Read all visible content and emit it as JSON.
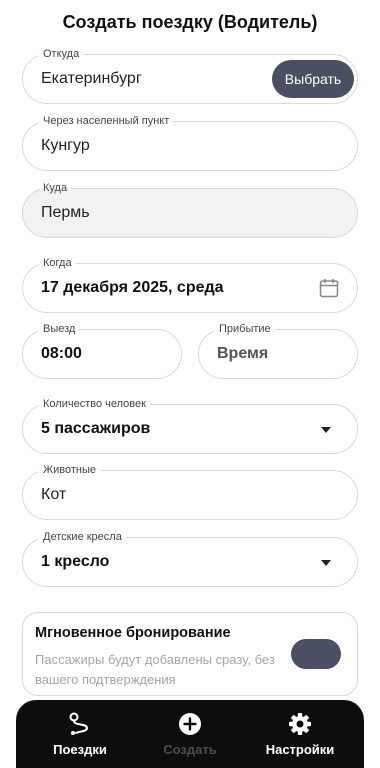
{
  "header": {
    "title": "Создать поездку (Водитель)"
  },
  "form": {
    "from": {
      "label": "Откуда",
      "value": "Екатеринбург",
      "button": "Выбрать"
    },
    "via": {
      "label": "Через населенный пункт",
      "value": "Кунгур"
    },
    "to": {
      "label": "Куда",
      "value": "Пермь"
    },
    "when": {
      "label": "Когда",
      "value": "17 декабря 2025, среда"
    },
    "departure": {
      "label": "Выезд",
      "value": "08:00"
    },
    "arrival": {
      "label": "Прибытие",
      "value": "Время"
    },
    "people": {
      "label": "Количество человек",
      "value": "5 пассажиров"
    },
    "animals": {
      "label": "Животные",
      "value": "Кот"
    },
    "child_seats": {
      "label": "Детские кресла",
      "value": "1 кресло"
    }
  },
  "instant_booking": {
    "title": "Мгновенное бронирование",
    "description": "Пассажиры будут добавлены сразу, без вашего подтверждения",
    "enabled": true
  },
  "nav": {
    "items": [
      {
        "label": "Поездки",
        "icon": "route-icon"
      },
      {
        "label": "Создать",
        "icon": "plus-circle-icon"
      },
      {
        "label": "Настройки",
        "icon": "gear-icon"
      }
    ]
  },
  "colors": {
    "accent": "#4a4f63",
    "nav_bg": "#0d0d0d",
    "disabled": "#4d4d4d"
  }
}
